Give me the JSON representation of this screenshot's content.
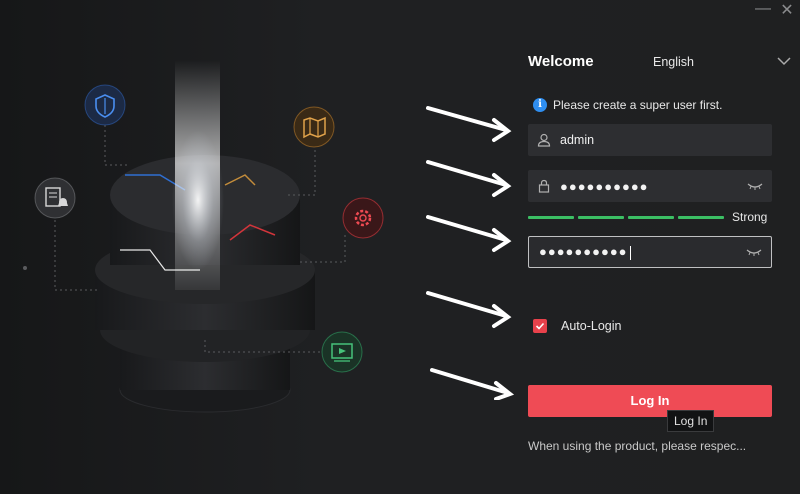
{
  "window": {
    "minimize_glyph": "—",
    "close_glyph": "✕"
  },
  "header": {
    "title": "Welcome",
    "language": "English",
    "language_icon": "chevron-down-icon"
  },
  "notice": {
    "text": "Please create a super user first.",
    "icon": "info-icon"
  },
  "form": {
    "username": {
      "value": "admin",
      "icon": "user-icon"
    },
    "password": {
      "masked_value": "●●●●●●●●●●",
      "icon": "lock-icon",
      "toggle_icon": "eye-closed-icon"
    },
    "confirm_password": {
      "masked_value": "●●●●●●●●●●",
      "toggle_icon": "eye-closed-icon"
    },
    "strength": {
      "label": "Strong",
      "level": 1.0,
      "color": "#3bbf64"
    },
    "auto_login": {
      "label": "Auto-Login",
      "checked": true
    }
  },
  "login_button": {
    "label": "Log In",
    "color": "#ef4b55"
  },
  "tooltip": {
    "text": "Log In"
  },
  "footer": {
    "text": "When using the product, please respec..."
  },
  "colors": {
    "background": "#1f2022",
    "accent": "#ef4b55",
    "info": "#2f8ef0",
    "field": "#2d2e31"
  },
  "illustration_icons": [
    "shield-icon",
    "map-icon",
    "document-bell-icon",
    "gear-icon",
    "video-icon"
  ]
}
